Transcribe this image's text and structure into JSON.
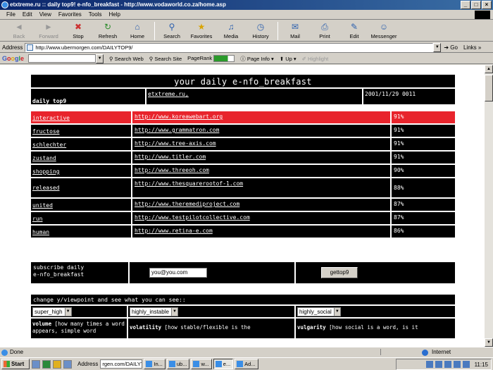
{
  "window": {
    "title": "etxtreme.ru :: daily top9! e-nfo_breakfast - http://www.vodaworld.co.za/home.asp"
  },
  "menu": [
    "File",
    "Edit",
    "View",
    "Favorites",
    "Tools",
    "Help"
  ],
  "toolbar": {
    "back": "Back",
    "forward": "Forward",
    "stop": "Stop",
    "refresh": "Refresh",
    "home": "Home",
    "search": "Search",
    "favorites": "Favorites",
    "media": "Media",
    "history": "History",
    "mail": "Mail",
    "print": "Print",
    "edit": "Edit",
    "messenger": "Messenger"
  },
  "address": {
    "label": "Address",
    "url": "http://www.ubermorgen.com/DAILYTOP9/",
    "go": "Go",
    "links": "Links"
  },
  "googlebar": {
    "logo": [
      "G",
      "o",
      "o",
      "g",
      "l",
      "e"
    ],
    "search_web": "Search Web",
    "search_site": "Search Site",
    "pagerank": "PageRank",
    "page_info": "Page Info",
    "up": "Up",
    "highlight": "Highlight"
  },
  "page": {
    "title": "your daily e-nfo_breakfast",
    "header_left": "daily top9",
    "header_mid": "etxtreme.ru,",
    "header_right": "2001/11/29 0011",
    "rows": [
      {
        "category": "interactive",
        "url": "http://www.koreawebart.org",
        "pct": "91%"
      },
      {
        "category": "fructose",
        "url": "http://www.grammatron.com",
        "pct": "91%"
      },
      {
        "category": "schlechter",
        "url": "http://www.tree-axis.com",
        "pct": "91%"
      },
      {
        "category": "zustand",
        "url": "http://www.titler.com",
        "pct": "91%"
      },
      {
        "category": "shopping",
        "url": "http://www.threeoh.com",
        "pct": "90%"
      },
      {
        "category": "released",
        "url": "http://www.thesquarerootof-1.com",
        "pct": "88%"
      },
      {
        "category": "united",
        "url": "http://www.theremediproject.com",
        "pct": "87%"
      },
      {
        "category": "run",
        "url": "http://www.testpilotcollective.com",
        "pct": "87%"
      },
      {
        "category": "human",
        "url": "http://www.retina-e.com",
        "pct": "86%"
      }
    ],
    "subscribe": {
      "label_line1": "subscribe daily",
      "label_line2": "e-nfo_breakfast",
      "email_value": "you@you.com",
      "button": "gettop9"
    },
    "viewpoint_text": "change y/viewpoint and see what you can see::",
    "selects": [
      "super_high",
      "highly_instable",
      "highly_social"
    ],
    "descriptions": {
      "volume_term": "volume",
      "volume_text": " [how many times a word appears, simple word",
      "volatility_term": "volatility",
      "volatility_text": " [how stable/flexible is the",
      "vulgarity_term": "vulgarity",
      "vulgarity_text": " [how social is a word, is it"
    }
  },
  "status": {
    "left": "Done",
    "right": "Internet"
  },
  "taskbar": {
    "start": "Start",
    "address_label": "Address",
    "address_value": "rgen.com/DAILYTOP9",
    "buttons": [
      "In...",
      "ub...",
      "w...",
      "e...",
      "Ad..."
    ],
    "clock": "11:15"
  }
}
